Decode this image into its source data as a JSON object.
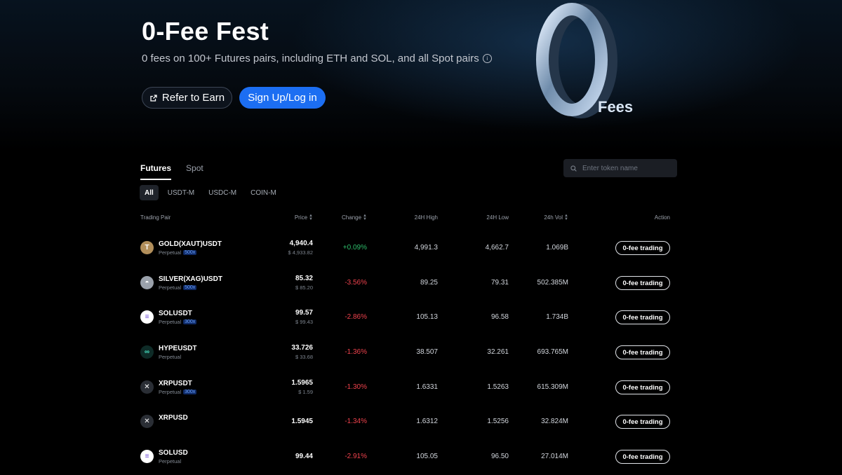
{
  "hero": {
    "title": "0-Fee Fest",
    "subtitle": "0 fees on 100+ Futures pairs, including ETH and SOL, and all Spot pairs",
    "refer_label": "Refer to Earn",
    "signup_label": "Sign Up/Log in",
    "art_digit": "0",
    "art_text": "Fees"
  },
  "tabs": [
    {
      "label": "Futures",
      "active": true
    },
    {
      "label": "Spot",
      "active": false
    }
  ],
  "search": {
    "placeholder": "Enter token name"
  },
  "filters": [
    {
      "label": "All",
      "active": true
    },
    {
      "label": "USDT-M",
      "active": false
    },
    {
      "label": "USDC-M",
      "active": false
    },
    {
      "label": "COIN-M",
      "active": false
    }
  ],
  "columns": {
    "pair": "Trading Pair",
    "price": "Price",
    "change": "Change",
    "high": "24H High",
    "low": "24H Low",
    "vol": "24h Vol",
    "action": "Action"
  },
  "colors": {
    "positive": "#2ebd6b",
    "negative": "#f0424d",
    "accent": "#1c6ef2"
  },
  "rows": [
    {
      "icon": "gold-token-icon",
      "glyph": "T",
      "icon_bg": "#b28f5b",
      "pair": "GOLD(XAUT)USDT",
      "type": "Perpetual",
      "leverage": "500x",
      "price": "4,940.4",
      "price_usd": "$ 4,933.82",
      "change": "+0.09%",
      "dir": "up",
      "high": "4,991.3",
      "low": "4,662.7",
      "vol": "1.069B",
      "action": "0-fee trading"
    },
    {
      "icon": "silver-token-icon",
      "glyph": "◓",
      "icon_bg": "#9aa1ab",
      "pair": "SILVER(XAG)USDT",
      "type": "Perpetual",
      "leverage": "500x",
      "price": "85.32",
      "price_usd": "$ 85.20",
      "change": "-3.56%",
      "dir": "down",
      "high": "89.25",
      "low": "79.31",
      "vol": "502.385M",
      "action": "0-fee trading"
    },
    {
      "icon": "solana-icon",
      "glyph": "≡",
      "icon_bg": "#ffffff",
      "pair": "SOLUSDT",
      "type": "Perpetual",
      "leverage": "300x",
      "price": "99.57",
      "price_usd": "$ 99.43",
      "change": "-2.86%",
      "dir": "down",
      "high": "105.13",
      "low": "96.58",
      "vol": "1.734B",
      "action": "0-fee trading"
    },
    {
      "icon": "hyperliquid-icon",
      "glyph": "∞",
      "icon_bg": "#0e2b27",
      "pair": "HYPEUSDT",
      "type": "Perpetual",
      "leverage": "",
      "price": "33.726",
      "price_usd": "$ 33.68",
      "change": "-1.36%",
      "dir": "down",
      "high": "38.507",
      "low": "32.261",
      "vol": "693.765M",
      "action": "0-fee trading"
    },
    {
      "icon": "xrp-icon",
      "glyph": "✕",
      "icon_bg": "#2a2e35",
      "pair": "XRPUSDT",
      "type": "Perpetual",
      "leverage": "300x",
      "price": "1.5965",
      "price_usd": "$ 1.59",
      "change": "-1.30%",
      "dir": "down",
      "high": "1.6331",
      "low": "1.5263",
      "vol": "615.309M",
      "action": "0-fee trading"
    },
    {
      "icon": "xrp-icon",
      "glyph": "✕",
      "icon_bg": "#2a2e35",
      "pair": "XRPUSD",
      "type": "",
      "leverage": "",
      "price": "1.5945",
      "price_usd": "",
      "change": "-1.34%",
      "dir": "down",
      "high": "1.6312",
      "low": "1.5256",
      "vol": "32.824M",
      "action": "0-fee trading"
    },
    {
      "icon": "solana-icon",
      "glyph": "≡",
      "icon_bg": "#ffffff",
      "pair": "SOLUSD",
      "type": "Perpetual",
      "leverage": "",
      "price": "99.44",
      "price_usd": "",
      "change": "-2.91%",
      "dir": "down",
      "high": "105.05",
      "low": "96.50",
      "vol": "27.014M",
      "action": "0-fee trading"
    }
  ]
}
